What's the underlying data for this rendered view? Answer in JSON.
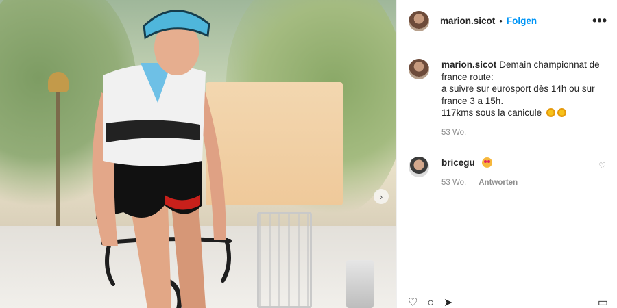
{
  "post": {
    "username": "marion.sicot",
    "separator": "•",
    "follow_label": "Folgen",
    "more_icon": "more-options-icon",
    "more_label": "•••"
  },
  "caption": {
    "username": "marion.sicot",
    "lines": [
      "Demain championnat de france route:",
      "a suivre sur eurosport dès 14h ou sur france 3 a 15h.",
      "117kms sous la canicule"
    ],
    "emoji": "sun-emoji",
    "time": "53 Wo."
  },
  "comments": [
    {
      "username": "bricegu",
      "emoji": "heart-eyes-emoji",
      "time": "53 Wo.",
      "reply_label": "Antworten",
      "like_icon": "heart-outline-icon",
      "like_glyph": "♡"
    }
  ],
  "carousel": {
    "next_icon": "chevron-right-icon",
    "next_glyph": "›"
  },
  "actions": {
    "like_glyph": "♡",
    "comment_glyph": "○",
    "share_glyph": "➤",
    "save_glyph": "▭"
  },
  "colors": {
    "accent": "#0095f6",
    "muted": "#8e8e8e",
    "text": "#262626"
  }
}
